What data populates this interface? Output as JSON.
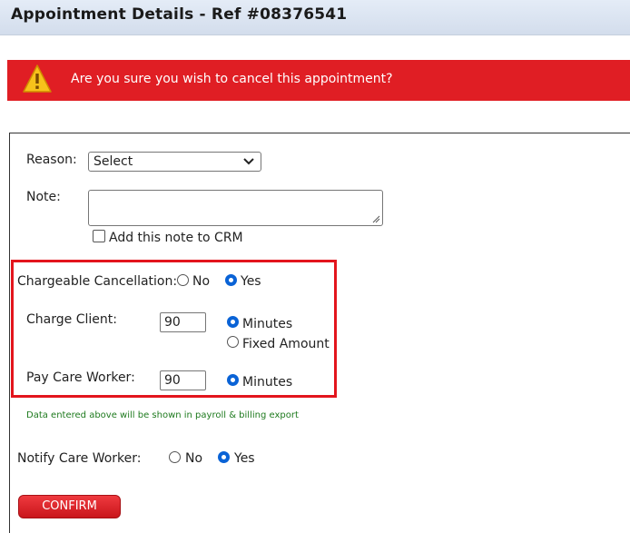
{
  "header": {
    "title": "Appointment Details - Ref #08376541"
  },
  "alert": {
    "icon": "warning-icon",
    "message": "Are you sure you wish to cancel this appointment?",
    "color": "#e01e24"
  },
  "form": {
    "reason": {
      "label": "Reason:",
      "selected": "Select"
    },
    "note": {
      "label": "Note:",
      "value": "",
      "crm_checkbox_label": "Add this note to CRM",
      "crm_checked": false
    },
    "chargeable": {
      "label": "Chargeable Cancellation:",
      "options": [
        "No",
        "Yes"
      ],
      "selected": "Yes"
    },
    "charge_client": {
      "label": "Charge Client:",
      "value": "90",
      "options": [
        "Minutes",
        "Fixed Amount"
      ],
      "selected": "Minutes"
    },
    "pay_care_worker": {
      "label": "Pay Care Worker:",
      "value": "90",
      "options": [
        "Minutes"
      ],
      "selected": "Minutes"
    },
    "export_note": "Data entered above will be shown in payroll & billing export",
    "notify": {
      "label": "Notify Care Worker:",
      "options": [
        "No",
        "Yes"
      ],
      "selected": "Yes"
    }
  },
  "actions": {
    "confirm_label": "CONFIRM"
  },
  "colors": {
    "highlight_border": "#e3151d",
    "radio_selected": "#0a63d6",
    "note_text": "#1e7a1e"
  }
}
